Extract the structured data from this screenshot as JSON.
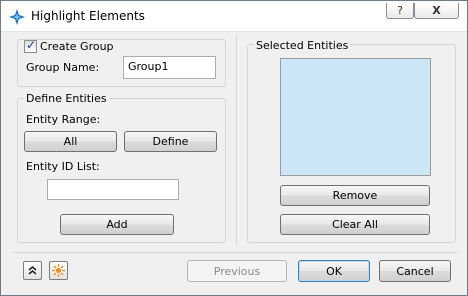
{
  "window": {
    "title": "Highlight Elements",
    "help_label": "?",
    "close_label": "X"
  },
  "create_group": {
    "checkbox_label": "Create Group",
    "checked": true,
    "group_name_label": "Group Name:",
    "group_name_value": "Group1"
  },
  "define_entities": {
    "legend": "Define Entities",
    "entity_range_label": "Entity Range:",
    "all_button": "All",
    "define_button": "Define",
    "entity_id_list_label": "Entity ID List:",
    "entity_id_value": "",
    "add_button": "Add"
  },
  "selected_entities": {
    "legend": "Selected Entities",
    "remove_button": "Remove",
    "clear_all_button": "Clear All"
  },
  "footer": {
    "collapse_icon": "double-chevron-up-icon",
    "highlight_icon": "sunburst-icon",
    "previous_button": "Previous",
    "ok_button": "OK",
    "cancel_button": "Cancel"
  },
  "colors": {
    "list_background": "#cde6f7",
    "icon_blue": "#1e6fb8",
    "icon_orange": "#f08a1c"
  }
}
